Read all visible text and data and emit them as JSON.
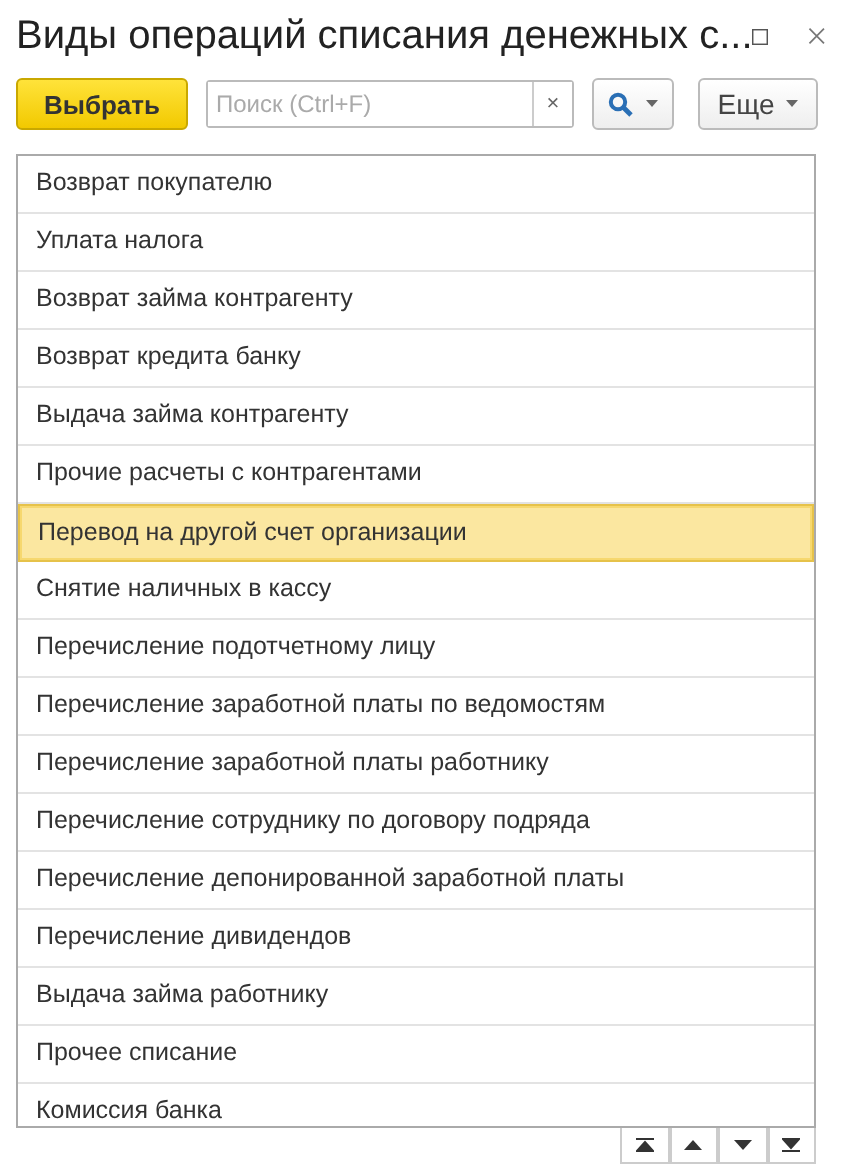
{
  "window": {
    "title": "Виды операций списания денежных с..."
  },
  "toolbar": {
    "select_button": "Выбрать",
    "search": {
      "placeholder": "Поиск (Ctrl+F)",
      "clear": "×"
    },
    "more_button": "Еще"
  },
  "list": {
    "rows": [
      {
        "label": "Возврат покупателю",
        "selected": false
      },
      {
        "label": "Уплата налога",
        "selected": false
      },
      {
        "label": "Возврат займа контрагенту",
        "selected": false
      },
      {
        "label": "Возврат кредита банку",
        "selected": false
      },
      {
        "label": "Выдача займа контрагенту",
        "selected": false
      },
      {
        "label": "Прочие расчеты с контрагентами",
        "selected": false
      },
      {
        "label": "Перевод на другой счет организации",
        "selected": true
      },
      {
        "label": "Снятие наличных в кассу",
        "selected": false
      },
      {
        "label": "Перечисление подотчетному лицу",
        "selected": false
      },
      {
        "label": "Перечисление заработной платы по ведомостям",
        "selected": false
      },
      {
        "label": "Перечисление заработной платы работнику",
        "selected": false
      },
      {
        "label": "Перечисление сотруднику по договору подряда",
        "selected": false
      },
      {
        "label": "Перечисление депонированной заработной платы",
        "selected": false
      },
      {
        "label": "Перечисление дивидендов",
        "selected": false
      },
      {
        "label": "Выдача займа работнику",
        "selected": false
      },
      {
        "label": "Прочее списание",
        "selected": false
      },
      {
        "label": "Комиссия банка",
        "selected": false
      }
    ]
  }
}
